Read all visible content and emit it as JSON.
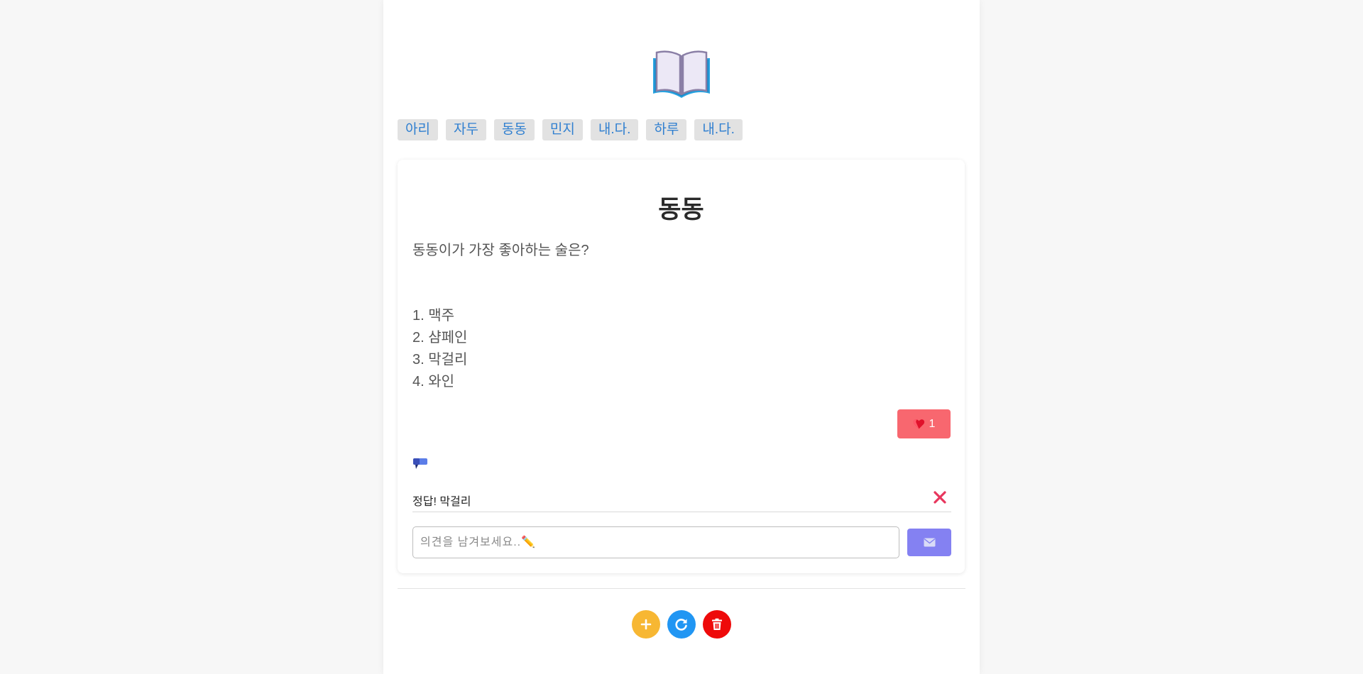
{
  "tabs": [
    "아리",
    "자두",
    "동동",
    "민지",
    "내.다.",
    "하루",
    "내.다."
  ],
  "card": {
    "title": "동동",
    "question": "동동이가 가장 좋아하는 술은?",
    "options": [
      "1. 맥주",
      "2. 샴페인",
      "3. 막걸리",
      "4. 와인"
    ],
    "likes": "1"
  },
  "comments": [
    {
      "text": "정답! 막걸리"
    }
  ],
  "comment_input": {
    "placeholder": "의견을 남겨보세요..✏️"
  },
  "colors": {
    "tab_text": "#2f7fd0",
    "like_button": "#f8676f",
    "send_button": "#8481f2",
    "add_button": "#f7b733",
    "refresh_button": "#2196f3",
    "delete_button": "#ee0a0a",
    "delete_x": "#e8365d"
  },
  "icons": {
    "logo": "open-book-icon",
    "like": "heart-icon",
    "comment": "speech-bubble-icon",
    "delete_comment": "close-icon",
    "send": "envelope-icon",
    "add": "plus-icon",
    "refresh": "refresh-icon",
    "delete": "trash-icon"
  }
}
